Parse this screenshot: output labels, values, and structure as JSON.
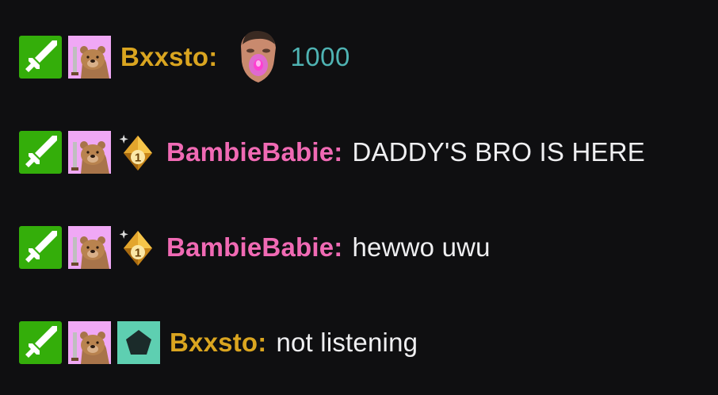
{
  "colors": {
    "background": "#0f0f11",
    "message_text": "#efeff1",
    "bxxsto_name": "#daa520",
    "bambiebabie_name": "#f06ab4",
    "cheer_amount": "#4fb3b3",
    "mod_badge": "#34ae0a",
    "sub_badge_bg": "#f0a8f5",
    "pentagon_badge_bg": "#5ecfb1"
  },
  "messages": [
    {
      "badges": [
        "moderator-sword-icon",
        "subscriber-bear-icon"
      ],
      "username": "Bxxsto",
      "colon": ":",
      "cheer": {
        "emote": "face-cheer-emote",
        "amount": "1000"
      },
      "text": ""
    },
    {
      "badges": [
        "moderator-sword-icon",
        "subscriber-bear-icon",
        "gift-gem-1-icon"
      ],
      "username": "BambieBabie",
      "colon": ":",
      "gem_number": "1",
      "text": "DADDY'S BRO IS HERE"
    },
    {
      "badges": [
        "moderator-sword-icon",
        "subscriber-bear-icon",
        "gift-gem-1-icon"
      ],
      "username": "BambieBabie",
      "colon": ":",
      "gem_number": "1",
      "text": "hewwo uwu"
    },
    {
      "badges": [
        "moderator-sword-icon",
        "subscriber-bear-icon",
        "pentagon-icon"
      ],
      "username": "Bxxsto",
      "colon": ":",
      "text": "not listening"
    }
  ]
}
